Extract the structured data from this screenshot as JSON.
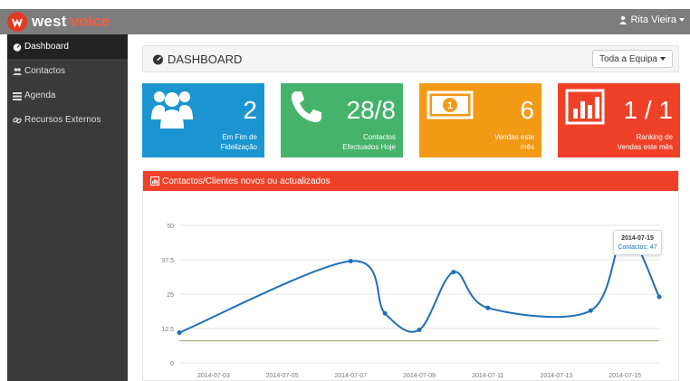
{
  "brand": {
    "name_part1": "west",
    "name_part2": "voice"
  },
  "user": {
    "name": "Rita Vieira"
  },
  "sidebar": {
    "items": [
      {
        "label": "Dashboard",
        "icon": "dashboard-icon"
      },
      {
        "label": "Contactos",
        "icon": "users-icon"
      },
      {
        "label": "Agenda",
        "icon": "list-icon"
      },
      {
        "label": "Recursos Externos",
        "icon": "link-icon"
      }
    ]
  },
  "header": {
    "title": "DASHBOARD",
    "team_button": "Toda a Equipa"
  },
  "cards": [
    {
      "value": "2",
      "label_line1": "Em Fim de",
      "label_line2": "Fidelização",
      "color": "#1b95d2",
      "icon": "users-icon"
    },
    {
      "value": "28/8",
      "label_line1": "Contactos",
      "label_line2": "Efectuados Hoje",
      "color": "#45b36b",
      "icon": "phone-icon"
    },
    {
      "value": "6",
      "label_line1": "Vendas este",
      "label_line2": "mês",
      "color": "#f39a15",
      "icon": "money-icon"
    },
    {
      "value": "1 / 1",
      "label_line1": "Ranking de",
      "label_line2": "Vendas este mês",
      "color": "#ef4128",
      "icon": "bar-chart-icon"
    }
  ],
  "panel": {
    "title": "Contactos/Clientes novos ou actualizados"
  },
  "tooltip": {
    "date": "2014-07-15",
    "text": "Contactos: 47"
  },
  "chart_data": {
    "type": "line",
    "x": [
      "2014-07-02",
      "2014-07-07",
      "2014-07-08",
      "2014-07-09",
      "2014-07-10",
      "2014-07-11",
      "2014-07-14",
      "2014-07-15",
      "2014-07-16"
    ],
    "series": [
      {
        "values": [
          11,
          37,
          18,
          12,
          33,
          20,
          19,
          47,
          24
        ],
        "color": "#1d6fb8"
      },
      {
        "values": [
          8,
          8,
          8,
          8,
          8,
          8,
          8,
          8,
          8
        ],
        "color": "#a09a6a"
      }
    ],
    "x_ticks": [
      "2014-07-03",
      "2014-07-05",
      "2014-07-07",
      "2014-07-09",
      "2014-07-11",
      "2014-07-13",
      "2014-07-15"
    ],
    "y_ticks": [
      "0",
      "12.5",
      "25",
      "37.5",
      "50"
    ],
    "ylim": [
      0,
      50
    ]
  }
}
